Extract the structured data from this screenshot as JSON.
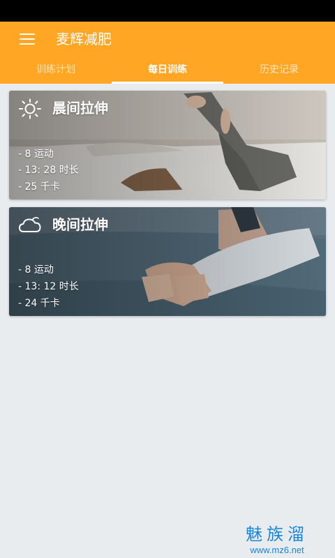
{
  "app_bar": {
    "title": "麦辉减肥",
    "menu_icon": "menu-icon"
  },
  "tabs": [
    {
      "label": "训练计划",
      "active": false
    },
    {
      "label": "每日训练",
      "active": true
    },
    {
      "label": "历史记录",
      "active": false
    }
  ],
  "colors": {
    "accent": "#ffa625",
    "page_background": "#e8ecef",
    "status_bar": "#000000"
  },
  "cards": [
    {
      "title": "晨间拉伸",
      "icon": "sun-icon",
      "exercises": "- 8 运动",
      "duration": "- 13: 28 时长",
      "calories": "- 25 千卡"
    },
    {
      "title": "晚间拉伸",
      "icon": "cloud-icon",
      "exercises": "- 8 运动",
      "duration": "- 13: 12 时长",
      "calories": "- 24 千卡"
    }
  ],
  "watermark": {
    "brand": "魅族溜",
    "url": "www.mz6.net"
  }
}
